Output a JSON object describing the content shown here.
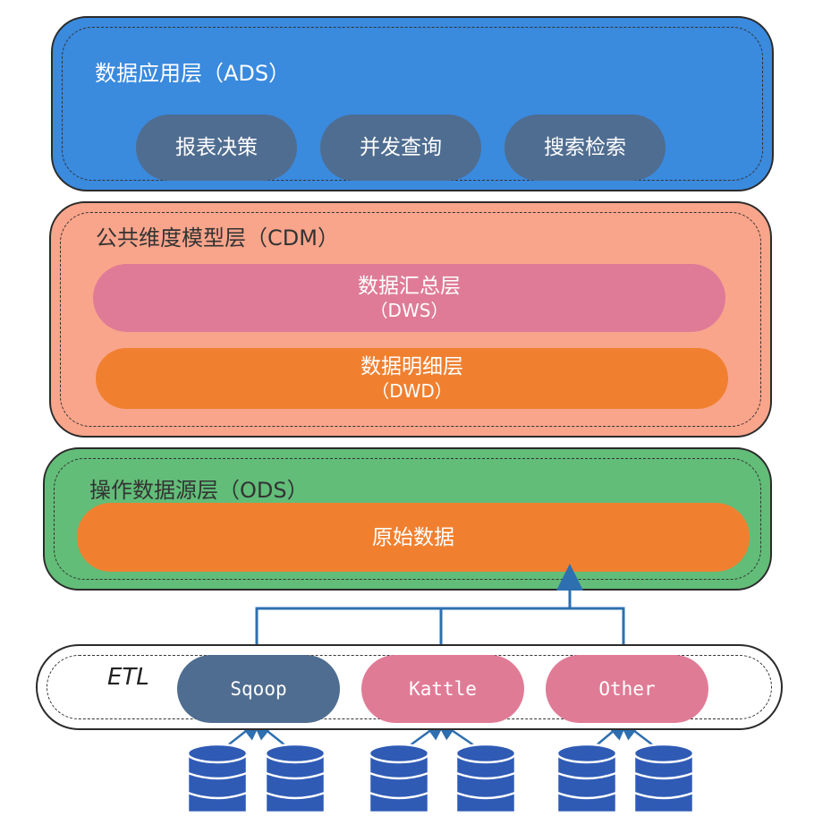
{
  "ads": {
    "title": "数据应用层（ADS）",
    "items": [
      "报表决策",
      "并发查询",
      "搜索检索"
    ]
  },
  "cdm": {
    "title": "公共维度模型层（CDM）",
    "dws": {
      "label": "数据汇总层",
      "sub": "（DWS）"
    },
    "dwd": {
      "label": "数据明细层",
      "sub": "（DWD）"
    }
  },
  "ods": {
    "title": "操作数据源层（ODS）",
    "raw": "原始数据"
  },
  "etl": {
    "label": "ETL",
    "tools": [
      "Sqoop",
      "Kattle",
      "Other"
    ]
  },
  "colors": {
    "ads_bg": "#3a8ade",
    "cdm_bg": "#f9a58b",
    "ods_bg": "#62bd78",
    "dws": "#df7b97",
    "dwd_raw": "#f08030",
    "sqoop": "#4f6d90",
    "kattle_other": "#e07b96",
    "database": "#2f5bb5",
    "arrow": "#2e6fb0"
  }
}
